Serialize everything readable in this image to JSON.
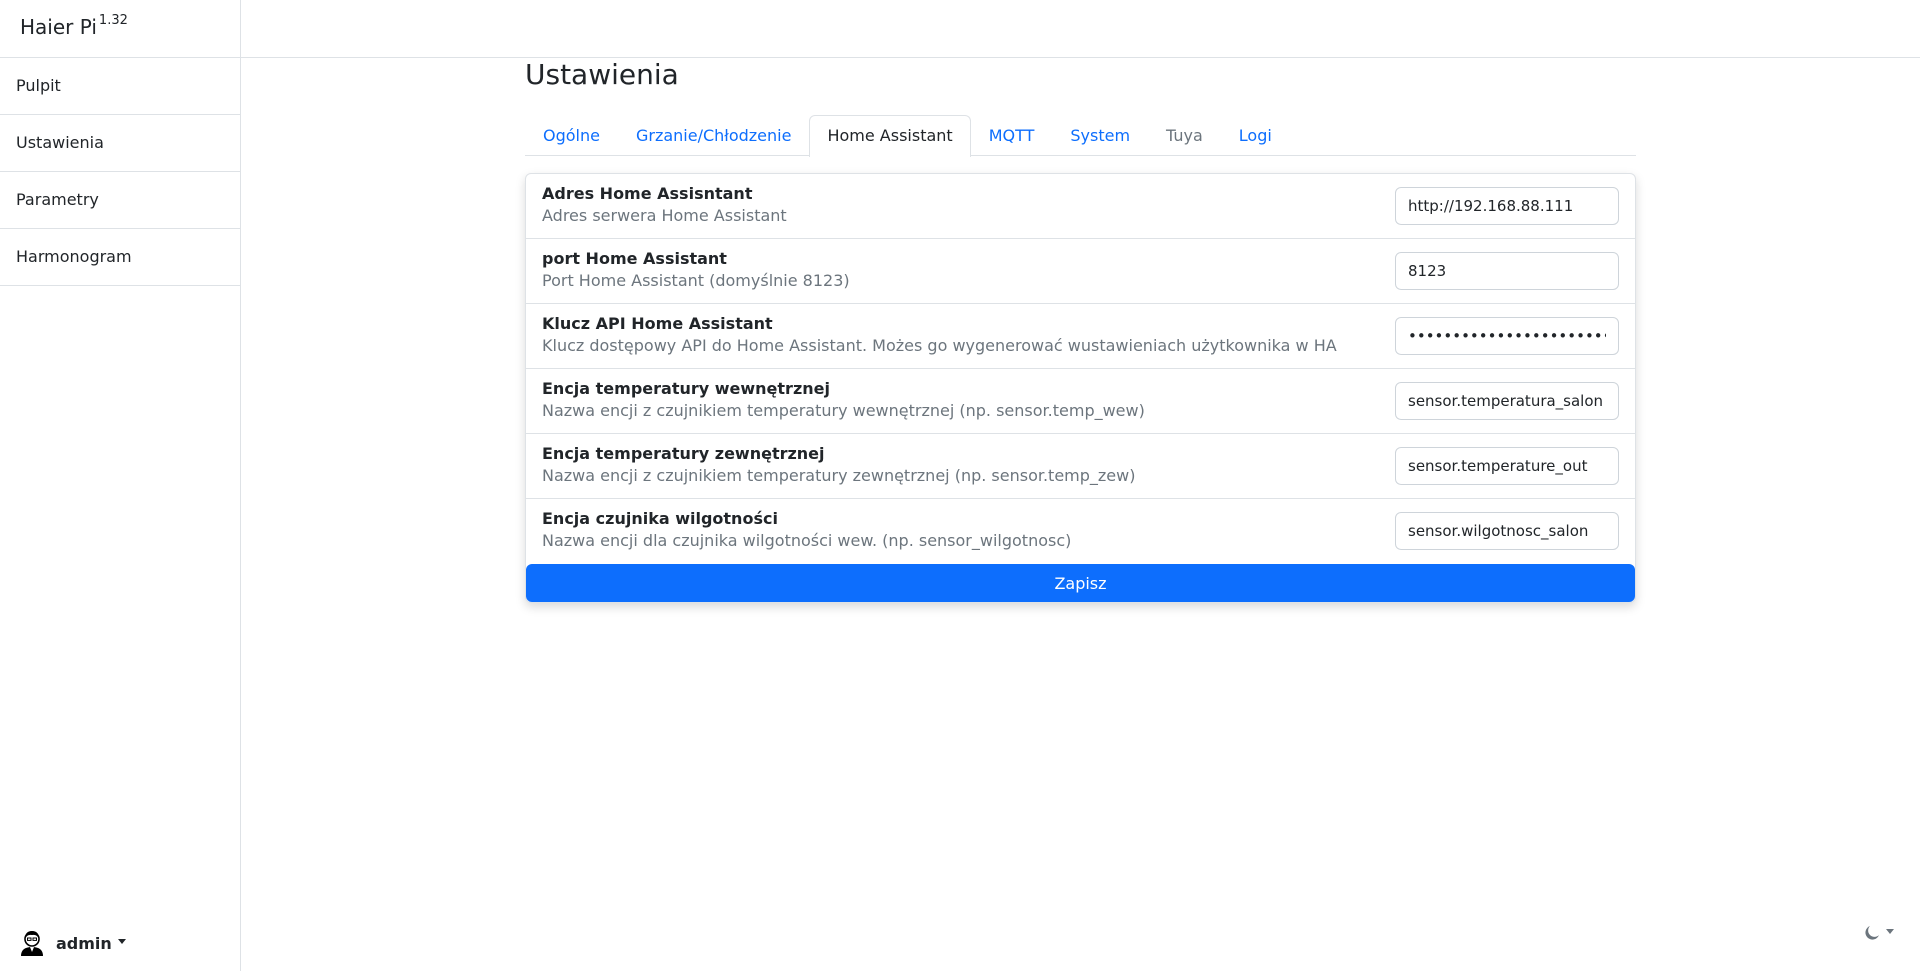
{
  "app": {
    "name": "Haier Pi",
    "version": "1.32"
  },
  "sidebar": {
    "items": [
      {
        "label": "Pulpit"
      },
      {
        "label": "Ustawienia"
      },
      {
        "label": "Parametry"
      },
      {
        "label": "Harmonogram"
      }
    ],
    "user": {
      "name": "admin",
      "icon": "user-avatar-icon"
    }
  },
  "page": {
    "title": "Ustawienia"
  },
  "tabs": [
    {
      "label": "Ogólne",
      "state": "link"
    },
    {
      "label": "Grzanie/Chłodzenie",
      "state": "link"
    },
    {
      "label": "Home Assistant",
      "state": "active"
    },
    {
      "label": "MQTT",
      "state": "link"
    },
    {
      "label": "System",
      "state": "link"
    },
    {
      "label": "Tuya",
      "state": "disabled"
    },
    {
      "label": "Logi",
      "state": "link"
    }
  ],
  "settings": [
    {
      "title": "Adres Home Assisntant",
      "description": "Adres serwera Home Assistant",
      "value": "http://192.168.88.111",
      "type": "text"
    },
    {
      "title": "port Home Assistant",
      "description": "Port Home Assistant (domyślnie 8123)",
      "value": "8123",
      "type": "text"
    },
    {
      "title": "Klucz API Home Assistant",
      "description": "Klucz dostępowy API do Home Assistant. Możes go wygenerować wustawieniach użytkownika w HA",
      "value": "••••••••••••••••••••••••••••••••",
      "type": "password"
    },
    {
      "title": "Encja temperatury wewnętrznej",
      "description": "Nazwa encji z czujnikiem temperatury wewnętrznej (np. sensor.temp_wew)",
      "value": "sensor.temperatura_salon",
      "type": "text"
    },
    {
      "title": "Encja temperatury zewnętrznej",
      "description": "Nazwa encji z czujnikiem temperatury zewnętrznej (np. sensor.temp_zew)",
      "value": "sensor.temperature_out",
      "type": "text"
    },
    {
      "title": "Encja czujnika wilgotności",
      "description": "Nazwa encji dla czujnika wilgotności wew. (np. sensor_wilgotnosc)",
      "value": "sensor.wilgotnosc_salon",
      "type": "text"
    }
  ],
  "save_label": "Zapisz",
  "theme": {
    "icon": "moon-icon"
  },
  "colors": {
    "primary": "#0d6efd",
    "muted": "#6c757d",
    "border": "#dee2e6"
  }
}
